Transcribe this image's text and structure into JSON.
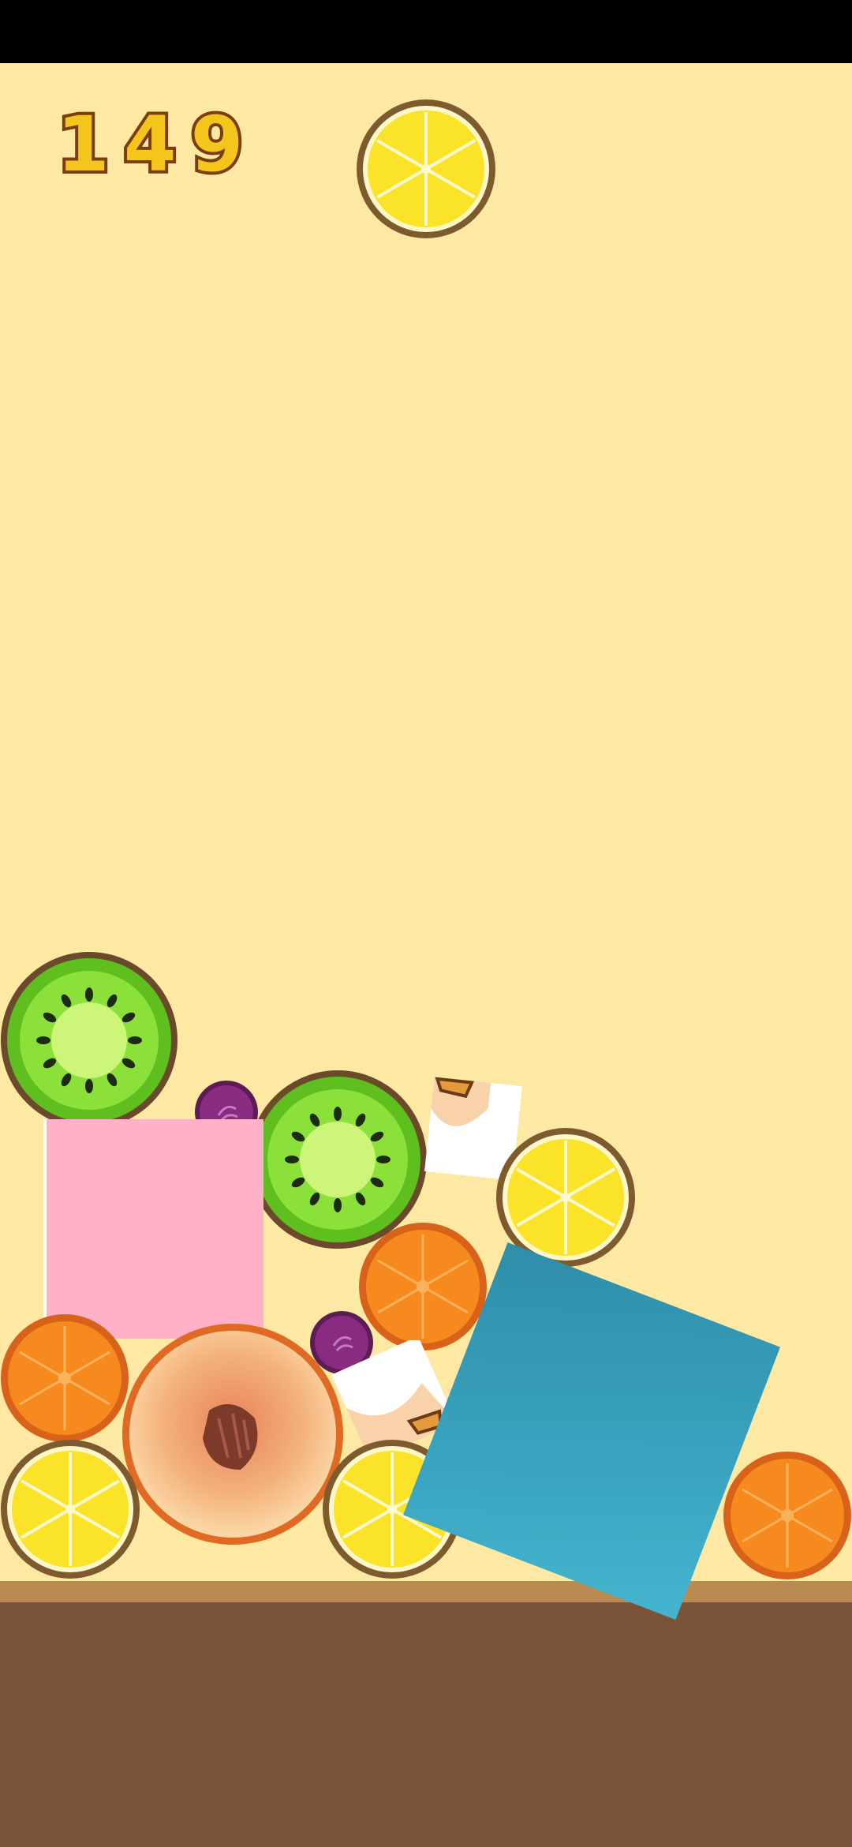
{
  "hud": {
    "score": "149",
    "next_fruit": "lemon"
  },
  "fruits": [
    {
      "type": "kiwi"
    },
    {
      "type": "grape"
    },
    {
      "type": "kiwi"
    },
    {
      "type": "peach-piece"
    },
    {
      "type": "lemon"
    },
    {
      "type": "pink-tile"
    },
    {
      "type": "orange"
    },
    {
      "type": "grape"
    },
    {
      "type": "orange"
    },
    {
      "type": "peach"
    },
    {
      "type": "peach-piece"
    },
    {
      "type": "lemon"
    },
    {
      "type": "lemon"
    },
    {
      "type": "blue-tile"
    },
    {
      "type": "orange"
    }
  ],
  "colors": {
    "background": "#fde9a3",
    "ground": "#7b533a",
    "ground_rim": "#b98b51",
    "score_fill": "#f4c61c",
    "score_outline": "#7a3e12",
    "lemon": "#fbe329",
    "orange": "#f78a1f",
    "kiwi": "#7fd12c",
    "grape": "#8a2b82",
    "peach": "#f7b27a",
    "pink_tile": "#ffb1c7",
    "blue_tile": "#3aa4c0"
  }
}
